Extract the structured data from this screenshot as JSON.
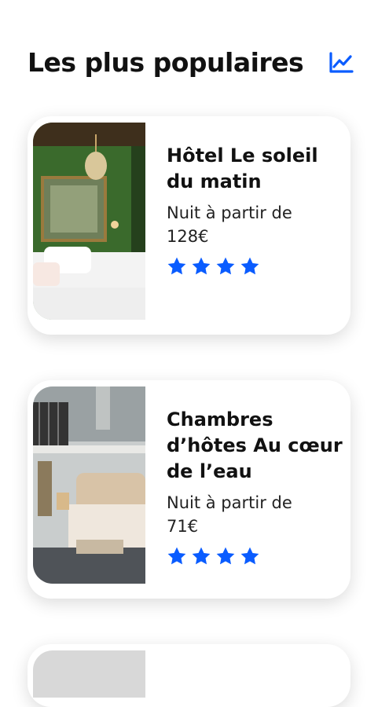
{
  "section": {
    "title": "Les plus populaires",
    "icon": "trending-chart-icon",
    "accent_color": "#0a5cff"
  },
  "hotels": [
    {
      "name": "Hôtel Le soleil du matin",
      "price_label": "Nuit à partir de",
      "price": "128€",
      "rating_stars": 4
    },
    {
      "name": "Chambres d’hôtes Au cœur de l’eau",
      "price_label": "Nuit à partir de",
      "price": "71€",
      "rating_stars": 4
    }
  ]
}
